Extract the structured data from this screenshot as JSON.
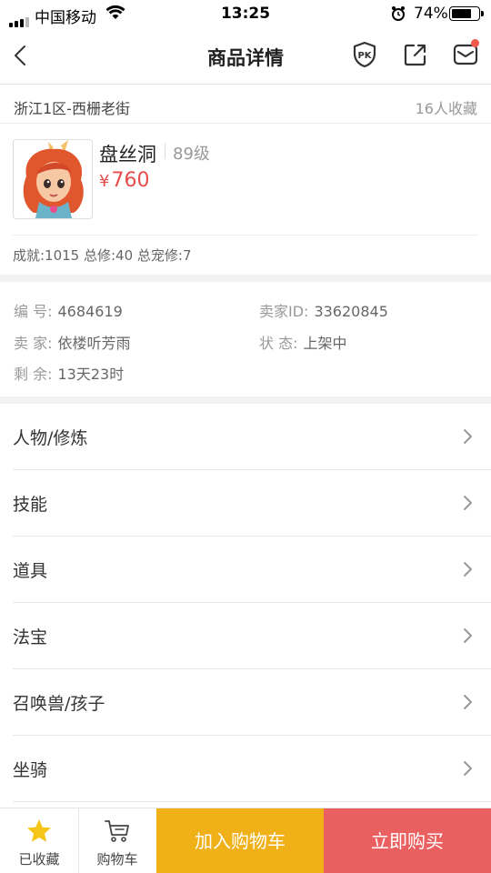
{
  "status_bar": {
    "carrier": "中国移动",
    "time": "13:25",
    "battery_percent_text": "74%",
    "battery_level": 0.74
  },
  "nav": {
    "title": "商品详情",
    "pk_icon_label": "PK"
  },
  "location": {
    "server": "浙江1区-西栅老街",
    "favorites": "16人收藏"
  },
  "item": {
    "name": "盘丝洞",
    "level": "89级",
    "price_symbol": "¥",
    "price": "760",
    "achievements": "成就:1015 总修:40 总宠修:7"
  },
  "info": {
    "serial_label": "编 号:",
    "serial_value": "4684619",
    "seller_id_label": "卖家ID:",
    "seller_id_value": "33620845",
    "seller_label": "卖 家:",
    "seller_value": "依楼听芳雨",
    "status_label": "状 态:",
    "status_value": "上架中",
    "remaining_label": "剩 余:",
    "remaining_value": "13天23时"
  },
  "menu": [
    {
      "label": "人物/修炼"
    },
    {
      "label": "技能"
    },
    {
      "label": "道具"
    },
    {
      "label": "法宝"
    },
    {
      "label": "召唤兽/孩子"
    },
    {
      "label": "坐骑"
    }
  ],
  "bottom": {
    "favorited_label": "已收藏",
    "cart_label": "购物车",
    "add_to_cart_label": "加入购物车",
    "buy_now_label": "立即购买"
  },
  "colors": {
    "price": "#e94c4c",
    "add_to_cart": "#f0b017",
    "buy_now": "#ea6060",
    "star": "#f5c518",
    "notification_dot": "#f15a4a"
  }
}
